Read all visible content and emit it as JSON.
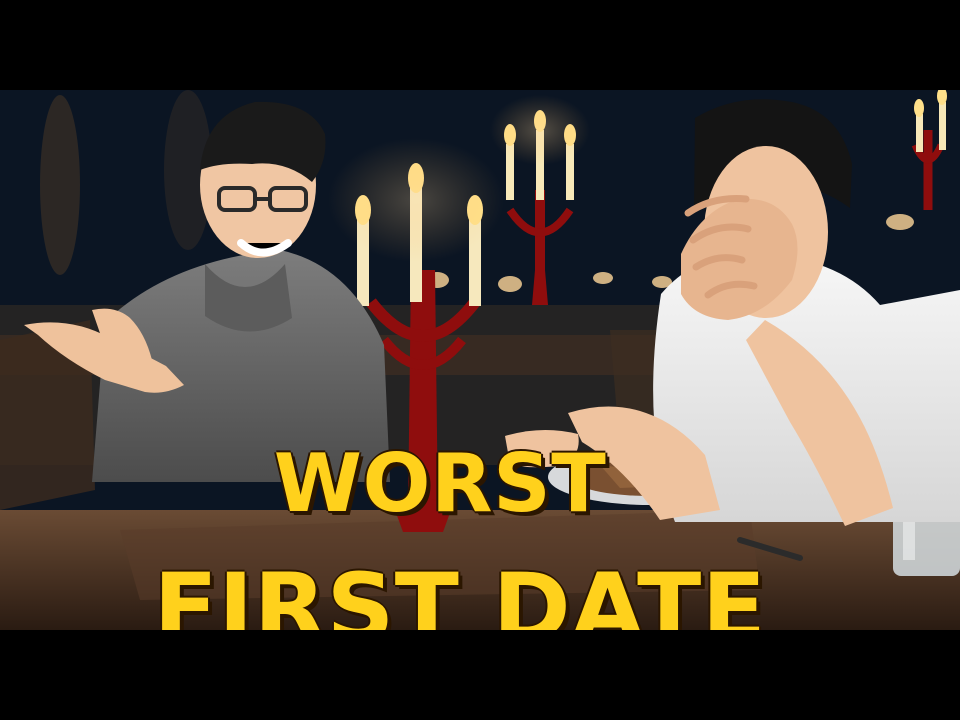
{
  "thumbnail": {
    "title_line1": "WORST",
    "title_line2": "FIRST DATE"
  },
  "colors": {
    "background": "#000000",
    "title_fill": "#ffd11c",
    "title_outline": "#2b1600",
    "candle_flame": "#ffe08a",
    "candelabra": "#8f0d0d"
  }
}
